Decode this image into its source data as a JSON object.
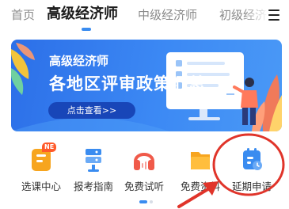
{
  "tabs": [
    {
      "label": "首页"
    },
    {
      "label": "高级经济师",
      "active": true
    },
    {
      "label": "中级经济师"
    },
    {
      "label": "初级经济"
    }
  ],
  "banner": {
    "title": "高级经济师",
    "headline": "各地区评审政策汇总",
    "button_label": "点击查看>>"
  },
  "entries": [
    {
      "label": "选课中心",
      "icon": "course-icon",
      "color": "#f7a51f",
      "badge": "NE"
    },
    {
      "label": "报考指南",
      "icon": "guide-icon",
      "color": "#3a8cf0"
    },
    {
      "label": "免费试听",
      "icon": "headphones-icon",
      "color": "#f05a4a"
    },
    {
      "label": "免费资料",
      "icon": "folder-icon",
      "color": "#f7a51f"
    },
    {
      "label": "延期申请",
      "icon": "calendar-icon",
      "color": "#3a8cf0"
    }
  ],
  "colors": {
    "accent": "#3a8cf0",
    "annotation_red": "#e0342a",
    "banner_blue": "#3c89f4"
  }
}
